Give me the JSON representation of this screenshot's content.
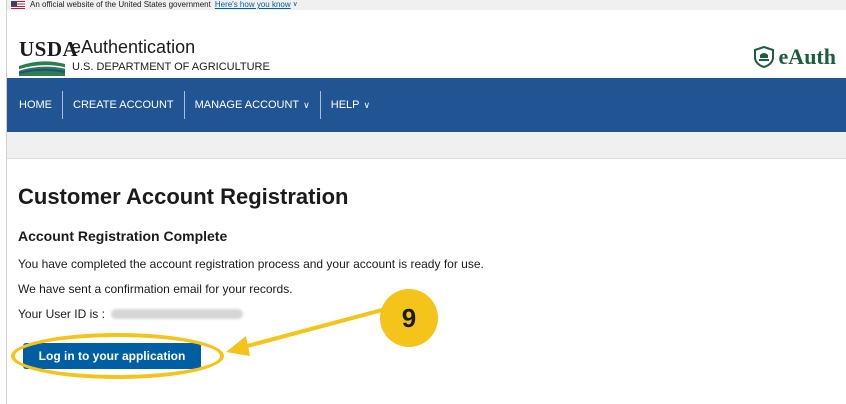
{
  "gov_banner": {
    "text": "An official website of the United States government",
    "link": "Here's how you know"
  },
  "header": {
    "logo_text": "USDA",
    "title": "eAuthentication",
    "subtitle": "U.S. DEPARTMENT OF AGRICULTURE",
    "brand": "eAuth"
  },
  "nav": {
    "items": [
      {
        "label": "HOME",
        "dropdown": false
      },
      {
        "label": "CREATE ACCOUNT",
        "dropdown": false
      },
      {
        "label": "MANAGE ACCOUNT",
        "dropdown": true
      },
      {
        "label": "HELP",
        "dropdown": true
      }
    ]
  },
  "main": {
    "page_title": "Customer Account Registration",
    "section_title": "Account Registration Complete",
    "message_1": "You have completed the account registration process and your account is ready for use.",
    "message_2": "We have sent a confirmation email for your records.",
    "user_id_label": "Your User ID is :",
    "login_button": "Log in to your application"
  },
  "annotation": {
    "step_number": "9",
    "color": "#f5c41b"
  },
  "colors": {
    "nav_bg": "#205493",
    "button_bg": "#005ea2",
    "brand_green": "#1d5c3c"
  }
}
